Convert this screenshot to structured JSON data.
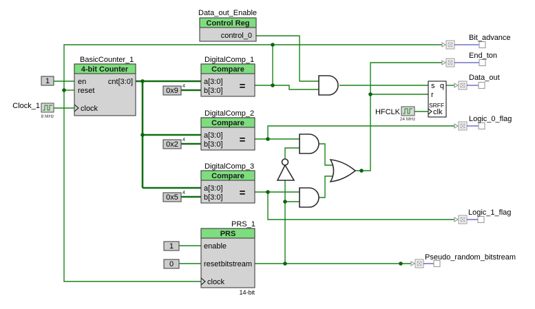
{
  "colors": {
    "wire_green": "#178217",
    "bus_green": "#116e11",
    "header_green": "#7edd7e",
    "body_gray": "#d3d3d3",
    "terminal_blue": "#5353c0"
  },
  "control_reg": {
    "title": "Data_out_Enable",
    "header": "Control Reg",
    "port": "control_0"
  },
  "counter": {
    "title": "BasicCounter_1",
    "header": "4-bit Counter",
    "en": "en",
    "reset": "reset",
    "clock": "clock",
    "out": "cnt[3:0]",
    "en_const": "1"
  },
  "clock1": {
    "name": "Clock_1",
    "freq": "8 MHz"
  },
  "hfclk": {
    "name": "HFCLK",
    "freq": "24 MHz"
  },
  "comp1": {
    "title": "DigitalComp_1",
    "header": "Compare",
    "a": "a[3:0]",
    "b": "b[3:0]",
    "eq": "=",
    "const": "0x9",
    "width": "4"
  },
  "comp2": {
    "title": "DigitalComp_2",
    "header": "Compare",
    "a": "a[3:0]",
    "b": "b[3:0]",
    "eq": "=",
    "const": "0x2",
    "width": "4"
  },
  "comp3": {
    "title": "DigitalComp_3",
    "header": "Compare",
    "a": "a[3:0]",
    "b": "b[3:0]",
    "eq": "=",
    "const": "0x5",
    "width": "4"
  },
  "srff": {
    "s": "s",
    "r": "r",
    "q": "q",
    "name": "SRFF",
    "clk": "clk"
  },
  "prs": {
    "title": "PRS_1",
    "header": "PRS",
    "enable": "enable",
    "reset": "reset",
    "bitstream": "bitstream",
    "clock": "clock",
    "bits": "14-bit",
    "enable_const": "1",
    "reset_const": "0"
  },
  "pins": {
    "bit_advance": "Bit_advance",
    "end_ton": "End_ton",
    "data_out": "Data_out",
    "logic_0_flag": "Logic_0_flag",
    "logic_1_flag": "Logic_1_flag",
    "prs_out": "Pseudo_random_bitstream"
  }
}
